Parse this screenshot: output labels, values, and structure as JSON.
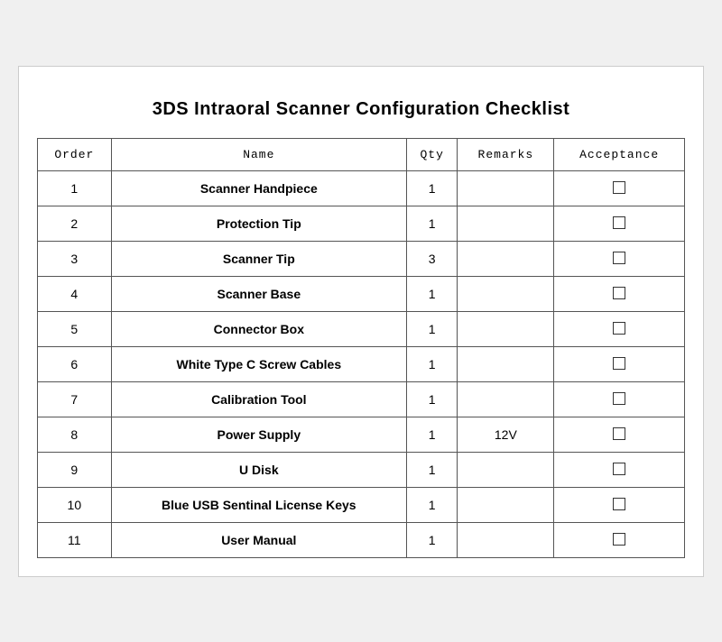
{
  "title": "3DS Intraoral Scanner Configuration Checklist",
  "columns": [
    "Order",
    "Name",
    "Qty",
    "Remarks",
    "Acceptance"
  ],
  "rows": [
    {
      "order": "1",
      "name": "Scanner Handpiece",
      "qty": "1",
      "remarks": "",
      "acceptance": "checkbox"
    },
    {
      "order": "2",
      "name": "Protection Tip",
      "qty": "1",
      "remarks": "",
      "acceptance": "checkbox"
    },
    {
      "order": "3",
      "name": "Scanner Tip",
      "qty": "3",
      "remarks": "",
      "acceptance": "checkbox"
    },
    {
      "order": "4",
      "name": "Scanner Base",
      "qty": "1",
      "remarks": "",
      "acceptance": "checkbox"
    },
    {
      "order": "5",
      "name": "Connector Box",
      "qty": "1",
      "remarks": "",
      "acceptance": "checkbox"
    },
    {
      "order": "6",
      "name": "White Type C Screw Cables",
      "qty": "1",
      "remarks": "",
      "acceptance": "checkbox"
    },
    {
      "order": "7",
      "name": "Calibration Tool",
      "qty": "1",
      "remarks": "",
      "acceptance": "checkbox"
    },
    {
      "order": "8",
      "name": "Power Supply",
      "qty": "1",
      "remarks": "12V",
      "acceptance": "checkbox"
    },
    {
      "order": "9",
      "name": "U Disk",
      "qty": "1",
      "remarks": "",
      "acceptance": "checkbox"
    },
    {
      "order": "10",
      "name": "Blue USB Sentinal License Keys",
      "qty": "1",
      "remarks": "",
      "acceptance": "checkbox"
    },
    {
      "order": "11",
      "name": "User Manual",
      "qty": "1",
      "remarks": "",
      "acceptance": "checkbox"
    }
  ]
}
